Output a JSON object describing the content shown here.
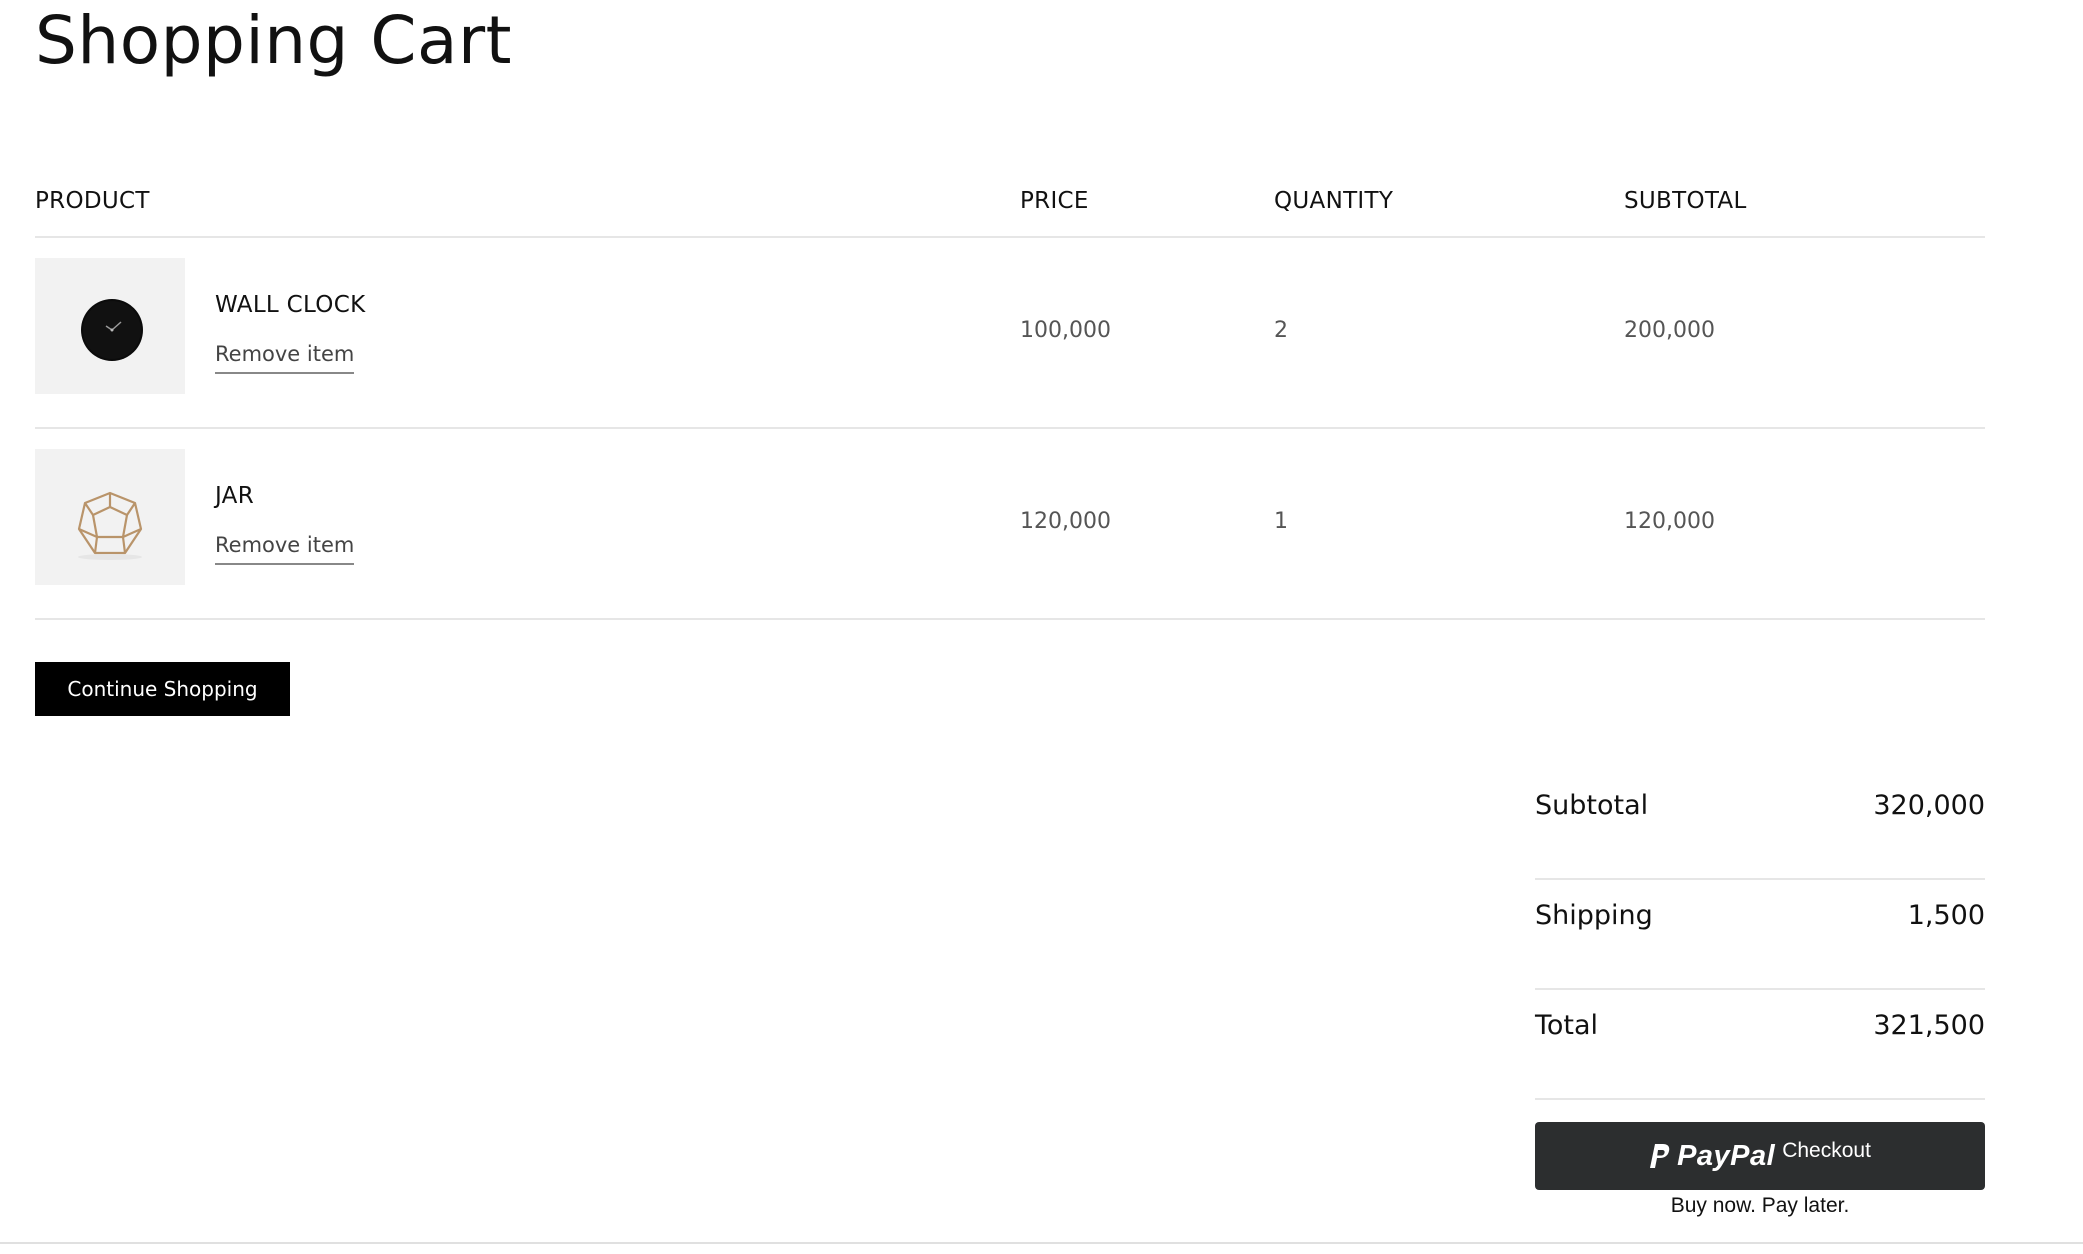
{
  "page": {
    "title": "Shopping Cart"
  },
  "table": {
    "headers": {
      "product": "PRODUCT",
      "price": "PRICE",
      "quantity": "QUANTITY",
      "subtotal": "SUBTOTAL"
    },
    "items": [
      {
        "name": "WALL CLOCK",
        "remove_label": "Remove item",
        "price": "100,000",
        "quantity": "2",
        "subtotal": "200,000",
        "image_icon": "wall-clock-icon"
      },
      {
        "name": "JAR",
        "remove_label": "Remove item",
        "price": "120,000",
        "quantity": "1",
        "subtotal": "120,000",
        "image_icon": "geometric-jar-icon"
      }
    ]
  },
  "actions": {
    "continue_label": "Continue Shopping"
  },
  "summary": {
    "subtotal_label": "Subtotal",
    "subtotal_value": "320,000",
    "shipping_label": "Shipping",
    "shipping_value": "1,500",
    "total_label": "Total",
    "total_value": "321,500"
  },
  "paypal": {
    "brand": "PayPal",
    "action": "Checkout",
    "tagline": "Buy now. Pay later.",
    "button_color": "#2c2e2f"
  },
  "colors": {
    "primary_button": "#000000",
    "divider": "#e6e6e6",
    "thumb_bg": "#f2f2f2"
  }
}
